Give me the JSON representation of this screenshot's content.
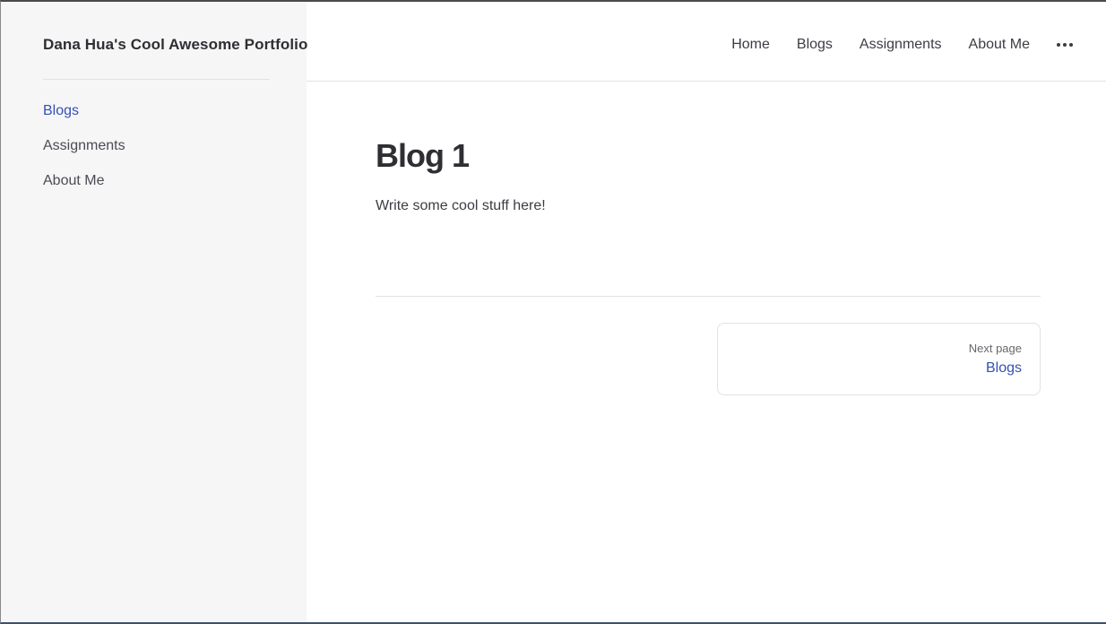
{
  "site": {
    "title": "Dana Hua's Cool Awesome Portfolio"
  },
  "top_nav": {
    "items": [
      {
        "label": "Home"
      },
      {
        "label": "Blogs"
      },
      {
        "label": "Assignments"
      },
      {
        "label": "About Me"
      }
    ],
    "more_icon": "ellipsis-icon"
  },
  "sidebar": {
    "items": [
      {
        "label": "Blogs",
        "active": true
      },
      {
        "label": "Assignments",
        "active": false
      },
      {
        "label": "About Me",
        "active": false
      }
    ]
  },
  "page": {
    "title": "Blog 1",
    "body": "Write some cool stuff here!"
  },
  "pager": {
    "next_desc": "Next page",
    "next_title": "Blogs"
  },
  "colors": {
    "accent": "#3451b2",
    "sidebar_bg": "#f6f6f7",
    "text": "#3c3c43",
    "divider": "#e2e2e3"
  }
}
